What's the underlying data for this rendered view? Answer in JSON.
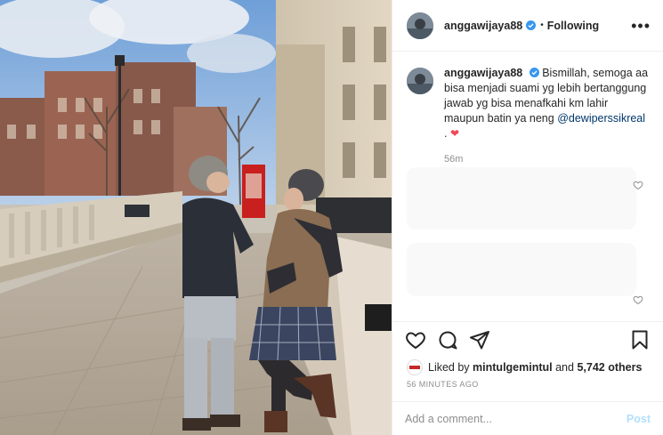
{
  "header": {
    "username": "anggawijaya88",
    "separator": "•",
    "follow_state": "Following",
    "more_label": "•••"
  },
  "caption": {
    "username": "anggawijaya88",
    "text": "Bismillah, semoga aa bisa menjadi suami yg lebih bertanggung jawab yg bisa menafkahi km lahir maupun batin ya neng",
    "mention": "@dewiperssikreal",
    "suffix": " . ",
    "emoji": "❤",
    "time": "56m"
  },
  "actions": {
    "icons": [
      "heart-icon",
      "comment-icon",
      "share-icon",
      "bookmark-icon"
    ]
  },
  "likes": {
    "prefix": "Liked by ",
    "user": "mintulgemintul",
    "middle": " and ",
    "count": "5,742 others"
  },
  "timestamp": "56 MINUTES AGO",
  "comment_box": {
    "placeholder": "Add a comment...",
    "post_label": "Post"
  },
  "colors": {
    "verified_blue": "#3897f0",
    "heart_red": "#ed4956",
    "mention_blue": "#00376b",
    "post_disabled": "#b2dffc"
  }
}
